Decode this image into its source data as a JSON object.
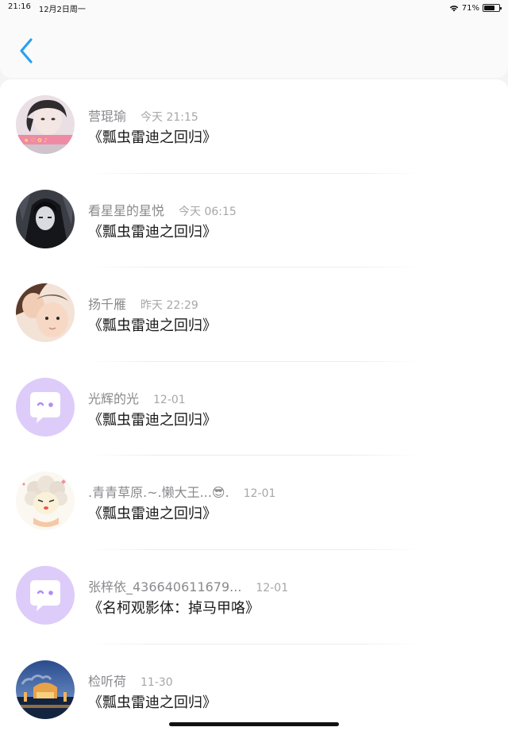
{
  "status": {
    "time": "21:16",
    "date": "12月2日周一",
    "battery": "71%",
    "battery_level": 0.71
  },
  "nav": {
    "back_icon": "chevron-left-icon",
    "accent": "#2aa1f2"
  },
  "comments": [
    {
      "name": "营琨瑜",
      "time": "今天 21:15",
      "title": "《瓢虫雷迪之回归》",
      "avatar": "photo-girl"
    },
    {
      "name": "看星星的星悦",
      "time": "今天 06:15",
      "title": "《瓢虫雷迪之回归》",
      "avatar": "photo-anime-dark"
    },
    {
      "name": "扬千雁",
      "time": "昨天 22:29",
      "title": "《瓢虫雷迪之回归》",
      "avatar": "photo-mother-baby"
    },
    {
      "name": "光辉的光",
      "time": "12-01",
      "title": "《瓢虫雷迪之回归》",
      "avatar": "default-chat-bubble"
    },
    {
      "name": ".青青草原.~.懒大王...😎.",
      "time": "12-01",
      "title": "《瓢虫雷迪之回归》",
      "avatar": "cartoon-sheep"
    },
    {
      "name": "张梓依_436640611679...",
      "time": "12-01",
      "title": "《名柯观影体：掉马甲咯》",
      "avatar": "default-chat-bubble"
    },
    {
      "name": "检听荷",
      "time": "11-30",
      "title": "《瓢虫雷迪之回归》",
      "avatar": "photo-palace-night"
    }
  ],
  "colors": {
    "name_text": "#8a8a8e",
    "time_text": "#a7a7ab",
    "title_text": "#1a1a1a",
    "default_avatar_bg": "#d9c8f7",
    "default_avatar_fg": "#b18cf0"
  }
}
